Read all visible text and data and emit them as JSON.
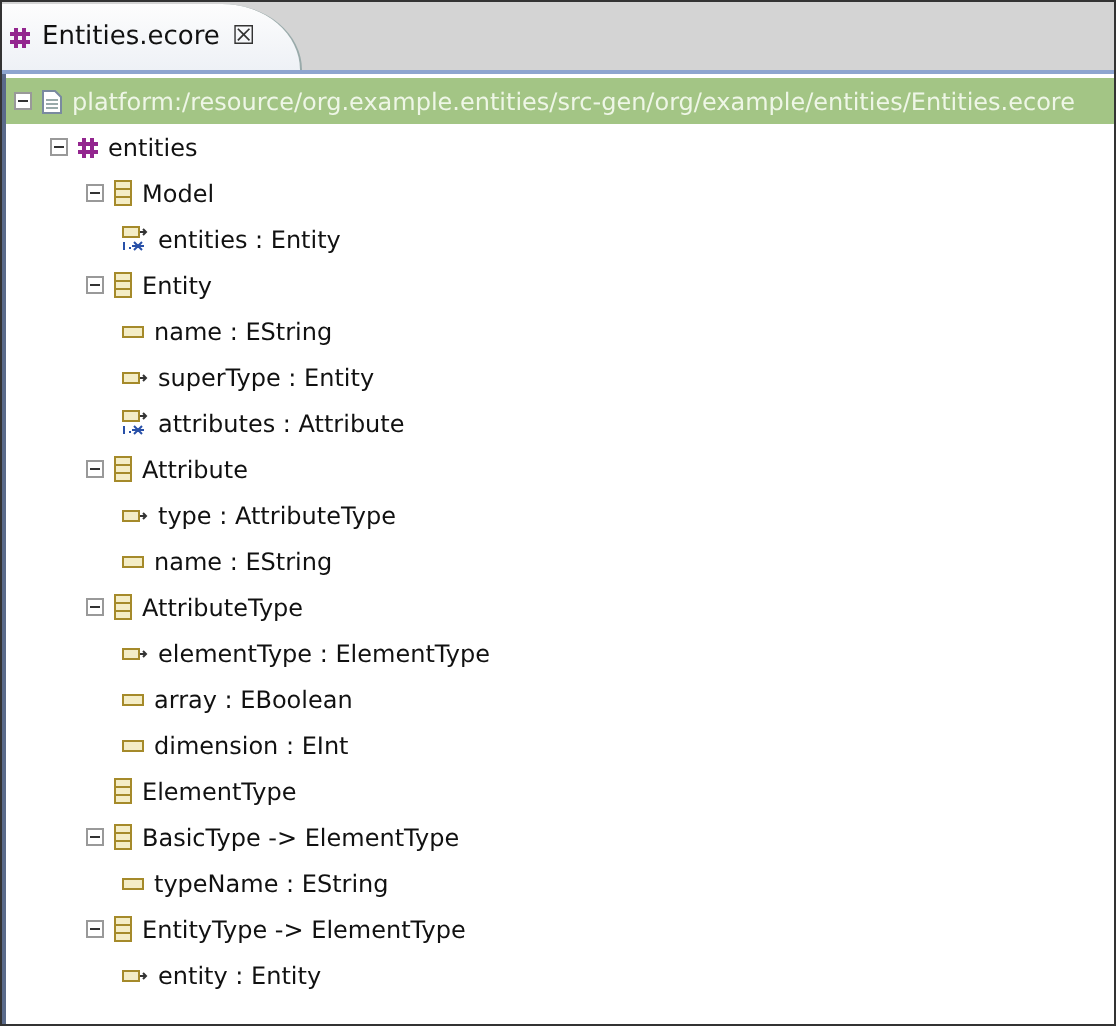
{
  "tab": {
    "label": "Entities.ecore",
    "close": "☒"
  },
  "tree": [
    {
      "kind": "resource",
      "label": "platform:/resource/org.example.entities/src-gen/org/example/entities/Entities.ecore",
      "selected": true,
      "expanded": true,
      "children": [
        {
          "kind": "package",
          "label": "entities",
          "selected": false,
          "expanded": true,
          "children": [
            {
              "kind": "class",
              "label": "Model",
              "selected": false,
              "expanded": true,
              "children": [
                {
                  "kind": "containment",
                  "label": "entities : Entity",
                  "selected": false
                }
              ]
            },
            {
              "kind": "class",
              "label": "Entity",
              "selected": false,
              "expanded": true,
              "children": [
                {
                  "kind": "attribute",
                  "label": "name : EString",
                  "selected": false
                },
                {
                  "kind": "reference",
                  "label": "superType : Entity",
                  "selected": false
                },
                {
                  "kind": "containment",
                  "label": "attributes : Attribute",
                  "selected": false
                }
              ]
            },
            {
              "kind": "class",
              "label": "Attribute",
              "selected": false,
              "expanded": true,
              "children": [
                {
                  "kind": "reference",
                  "label": "type : AttributeType",
                  "selected": false
                },
                {
                  "kind": "attribute",
                  "label": "name : EString",
                  "selected": false
                }
              ]
            },
            {
              "kind": "class",
              "label": "AttributeType",
              "selected": false,
              "expanded": true,
              "children": [
                {
                  "kind": "reference",
                  "label": "elementType : ElementType",
                  "selected": false
                },
                {
                  "kind": "attribute",
                  "label": "array : EBoolean",
                  "selected": false
                },
                {
                  "kind": "attribute",
                  "label": "dimension : EInt",
                  "selected": false
                }
              ]
            },
            {
              "kind": "class",
              "label": "ElementType",
              "selected": false
            },
            {
              "kind": "class",
              "label": "BasicType -> ElementType",
              "selected": false,
              "expanded": true,
              "children": [
                {
                  "kind": "attribute",
                  "label": "typeName : EString",
                  "selected": false
                }
              ]
            },
            {
              "kind": "class",
              "label": "EntityType -> ElementType",
              "selected": false,
              "expanded": true,
              "children": [
                {
                  "kind": "reference",
                  "label": "entity : Entity",
                  "selected": false
                }
              ]
            }
          ]
        }
      ]
    }
  ]
}
